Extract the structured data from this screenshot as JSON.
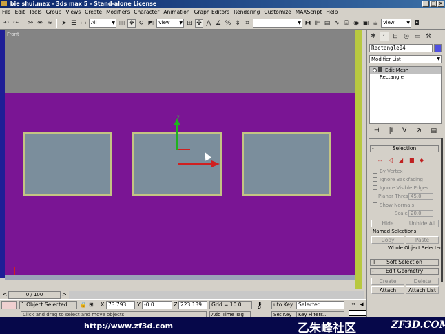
{
  "window": {
    "title": "bie shui.max - 3ds max 5 - Stand-alone License"
  },
  "menu": [
    "File",
    "Edit",
    "Tools",
    "Group",
    "Views",
    "Create",
    "Modifiers",
    "Character",
    "Animation",
    "Graph Editors",
    "Rendering",
    "Customize",
    "MAXScript",
    "Help"
  ],
  "toolbar": {
    "selection_filter": "All",
    "ref_coord": "View",
    "named_selection": "",
    "view_dropdown": "View"
  },
  "viewport": {
    "label": "Front",
    "gizmo_axis_y": "y"
  },
  "time_slider": {
    "frame": "0 / 100",
    "left_arrow": "<",
    "right_arrow": ">"
  },
  "status": {
    "selection": "1 Object Selected",
    "x_label": "X",
    "x_value": "73.793",
    "y_label": "Y",
    "y_value": "-0.0",
    "z_label": "Z",
    "z_value": "223.139",
    "grid": "Grid = 10.0",
    "auto_key": "uto Key",
    "auto_key_value": "Selected",
    "set_key": "Set Key",
    "key_filters": "Key Filters...",
    "hint": "Click and drag to select and move objects",
    "add_time_tag": "Add Time Tag"
  },
  "footer": {
    "url": "http://www.zf3d.com",
    "brand_cn": "乙朱峰社区",
    "brand_logo": "ZF3D.COM"
  },
  "command_panel": {
    "object_name": "Rectangle04",
    "color": "#5050e0",
    "modifier_list": "Modifier List",
    "stack": [
      "Edit Mesh",
      "Rectangle"
    ],
    "selection_rollout": {
      "title": "Selection",
      "by_vertex": "By Vertex",
      "ignore_backfacing": "Ignore Backfacing",
      "ignore_visible_edges": "Ignore Visible Edges",
      "planar_thresh_label": "Planar Thresh",
      "planar_thresh_value": "45.0",
      "show_normals": "Show Normals",
      "scale_label": "Scale",
      "scale_value": "20.0",
      "hide": "Hide",
      "unhide_all": "Unhide All",
      "named_selections": "Named Selections:",
      "copy": "Copy",
      "paste": "Paste",
      "whole_object": "Whole Object Selected"
    },
    "soft_selection_title": "Soft Selection",
    "edit_geometry_title": "Edit Geometry",
    "create": "Create",
    "delete": "Delete",
    "attach": "Attach",
    "attach_list": "Attach List"
  },
  "colors": {
    "viewport_bg": "#7a1594",
    "panel_fill": "#7b8e9c",
    "panel_border": "#c4c483"
  }
}
